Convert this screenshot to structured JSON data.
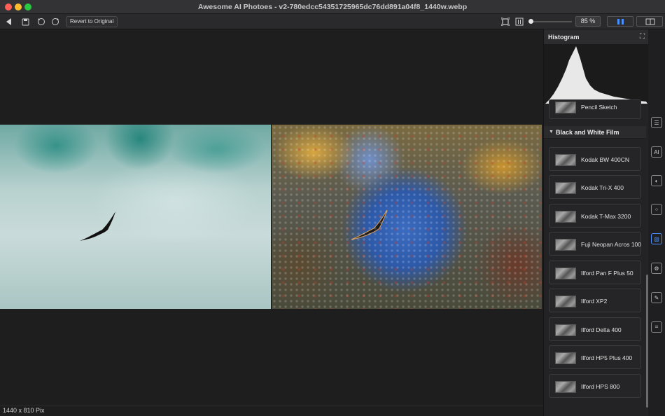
{
  "window": {
    "title": "Awesome AI Photoes  - v2-780edcc54351725965dc76dd891a04f8_1440w.webp"
  },
  "toolbar": {
    "back_icon": "back-arrow-icon",
    "save_icon": "save-icon",
    "rotate_left_icon": "rotate-left-icon",
    "rotate_right_icon": "rotate-right-icon",
    "revert_label": "Revert to Original",
    "fit_icon": "fit-screen-icon",
    "compare_icon": "compare-icon",
    "zoom_value": "85 %",
    "zoom_slider_level": 0.0
  },
  "status": {
    "dimensions": "1440 x 810 Pix"
  },
  "panel": {
    "histogram_title": "Histogram",
    "partial_preset": "Pencil Sketch",
    "section_title": "Black and White Film",
    "presets": [
      "Kodak BW 400CN",
      "Kodak Tri-X 400",
      "Kodak T-Max 3200",
      "Fuji Neopan Acros 100",
      "Ilford Pan F Plus 50",
      "Ilford XP2",
      "Ilford Delta 400",
      "Ilford HP5 Plus 400",
      "Ilford HPS 800"
    ]
  },
  "side_tools": [
    {
      "icon": "adjustments-icon",
      "active": false
    },
    {
      "icon": "ai-icon",
      "active": false
    },
    {
      "icon": "lens-icon",
      "active": false
    },
    {
      "icon": "texture-icon",
      "active": false
    },
    {
      "icon": "film-icon",
      "active": true
    },
    {
      "icon": "gear-icon",
      "active": false
    },
    {
      "icon": "brush-icon",
      "active": false
    },
    {
      "icon": "crop-icon",
      "active": false
    }
  ],
  "colors": {
    "accent": "#4a90ff",
    "panel_bg": "#232325",
    "canvas_bg": "#1e1e1e"
  }
}
